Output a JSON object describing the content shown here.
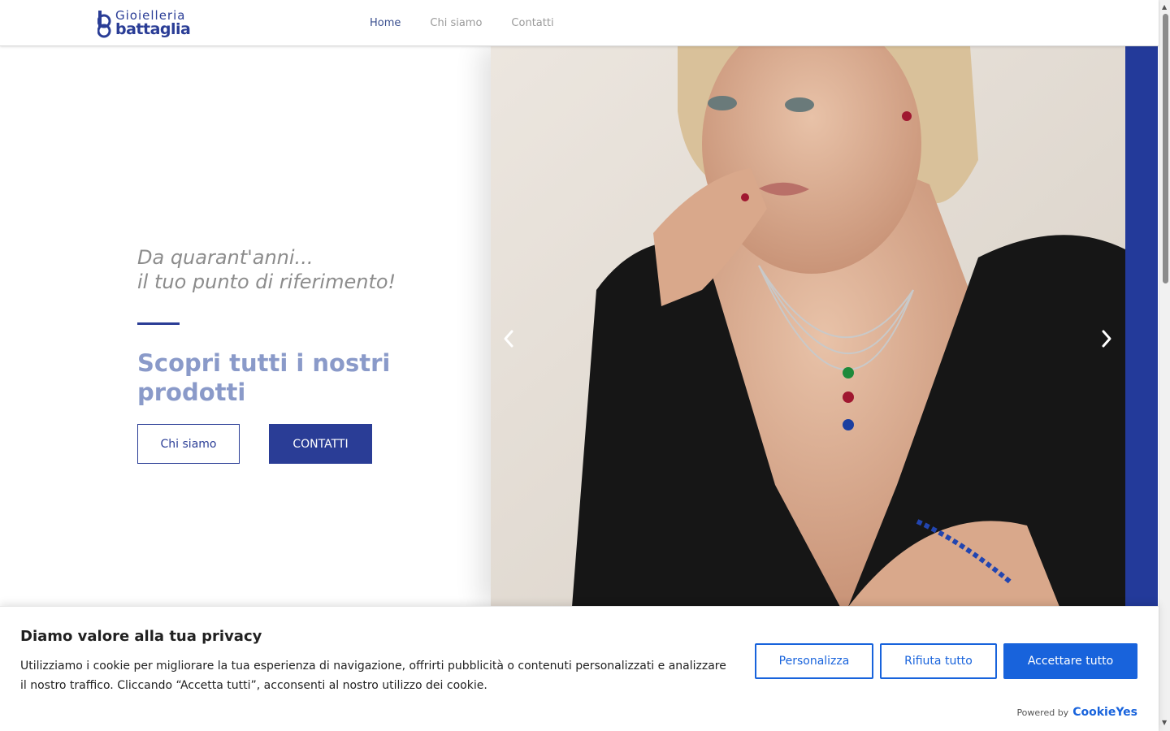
{
  "header": {
    "logo": {
      "line1": "Gioielleria",
      "line2": "battaglia"
    },
    "nav": [
      {
        "label": "Home",
        "active": true
      },
      {
        "label": "Chi siamo",
        "active": false
      },
      {
        "label": "Contatti",
        "active": false
      }
    ]
  },
  "hero": {
    "tagline_line1": "Da quarant'anni...",
    "tagline_line2": "il tuo punto di riferimento!",
    "subtitle": "Scopri tutti i nostri prodotti",
    "button_primary": "Chi siamo",
    "button_secondary": "CONTATTI",
    "image_icon": "jewelry-model-photo"
  },
  "cookie": {
    "title": "Diamo valore alla tua privacy",
    "text": "Utilizziamo i cookie per migliorare la tua esperienza di navigazione, offrirti pubblicità o contenuti personalizzati e analizzare il nostro traffico. Cliccando “Accetta tutti”, acconsenti al nostro utilizzo dei cookie.",
    "customize_label": "Personalizza",
    "reject_label": "Rifiuta tutto",
    "accept_label": "Accettare tutto",
    "powered_label": "Powered by",
    "powered_brand": "CookieYes"
  },
  "colors": {
    "brand_blue": "#2a3d96",
    "cookie_blue": "#1863dc",
    "subtitle_blue": "#8a9ac9"
  }
}
